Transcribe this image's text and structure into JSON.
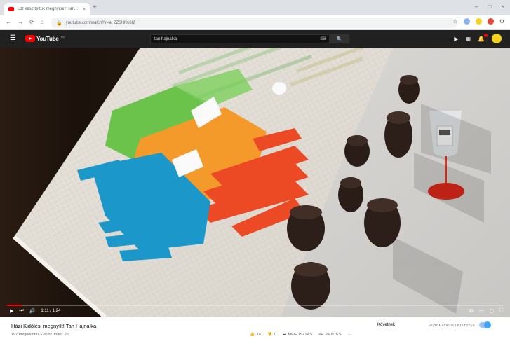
{
  "browser": {
    "tab_title": "Ezt készítettük megnyitni? Tan...",
    "tab_close": "×",
    "new_tab": "+",
    "window_controls": [
      "–",
      "□",
      "×"
    ],
    "nav": [
      "←",
      "→",
      "⟳",
      "⌂"
    ],
    "url": "youtube.com/watch?v=a_ZZ5HhK6I2",
    "lock_icon": "🔒",
    "ext_icons": [
      "☆",
      "⚙"
    ],
    "ext_colors": [
      "#8ab4f8",
      "#f6d31c",
      "#ea4335"
    ]
  },
  "youtube": {
    "logo_text": "YouTube",
    "logo_sup": "HU",
    "search_value": "tan hajnalka",
    "keyboard_icon": "⌨",
    "search_icon": "🔍",
    "header_icons": [
      "▶",
      "▦",
      "🔔"
    ]
  },
  "player": {
    "progress_fraction": 0.03,
    "time": "1:11 / 1:24",
    "left_icons": [
      "▶",
      "⏭",
      "🔊"
    ],
    "right_icons": [
      "⚙",
      "▭",
      "▢",
      "⛶"
    ]
  },
  "video_info": {
    "title": "Házi Kidőlési megnyílt! Tan Hajnalka",
    "meta": "197 megtekintés • 2020. márc. 25.",
    "subscribe": "Követnek",
    "autoplay_label": "AUTOMATIKUS LEJÁTSZÁS",
    "likes": "14",
    "dislikes": "0",
    "share": "MEGOSZTÁS",
    "save": "MENTÉS",
    "more": "···"
  }
}
